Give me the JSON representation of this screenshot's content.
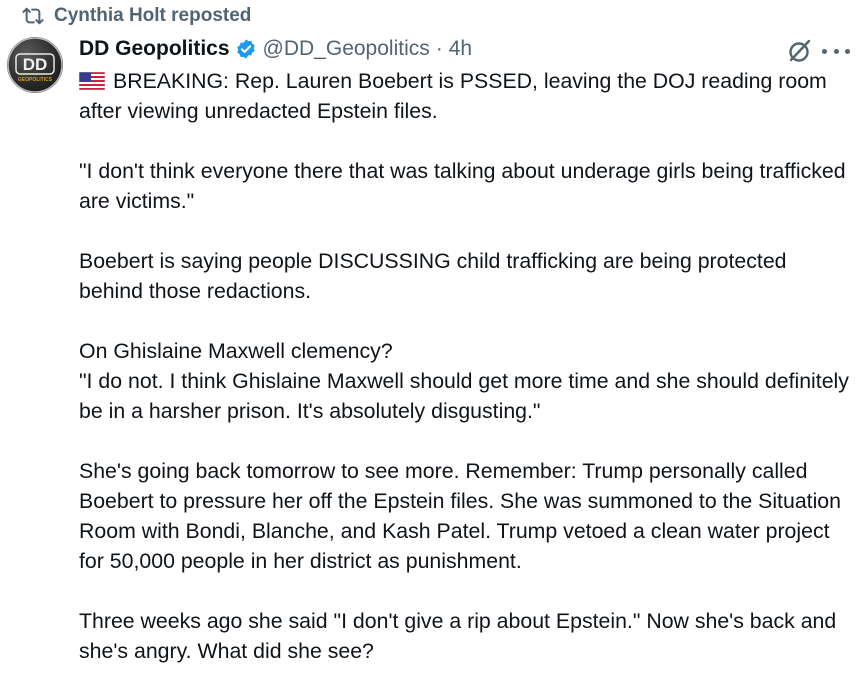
{
  "repost": {
    "label": "Cynthia Holt reposted",
    "icon": "repost-icon"
  },
  "author": {
    "avatar_text": "DD",
    "avatar_subtext": "GEOPOLITICS",
    "display_name": "DD Geopolitics",
    "verified_icon": "verified-badge-icon",
    "verified_color": "#1d9bf0",
    "handle": "@DD_Geopolitics",
    "separator": "·",
    "time": "4h"
  },
  "actions": {
    "grok_icon": "grok-icon",
    "more_icon": "more-icon"
  },
  "tweet": {
    "flag_icon": "us-flag-icon",
    "paragraphs": [
      "BREAKING: Rep. Lauren Boebert is PSSED, leaving the DOJ reading room after viewing unredacted Epstein files.",
      "\"I don't think everyone there that was talking about underage girls being trafficked are victims.\"",
      "Boebert is saying people DISCUSSING child trafficking are being protected behind those redactions.",
      "On Ghislaine Maxwell clemency?",
      "\"I do not. I think Ghislaine Maxwell should get more time and she should definitely be in a harsher prison. It's absolutely disgusting.\"",
      "She's going back tomorrow to see more. Remember: Trump personally called Boebert to pressure her off the Epstein files. She was summoned to the Situation Room with Bondi, Blanche, and Kash Patel. Trump vetoed a clean water project for 50,000 people in her district as punishment.",
      "Three weeks ago she said \"I don't give a rip about Epstein.\" Now she's back and she's angry. What did she see?"
    ]
  },
  "colors": {
    "text": "#0f1419",
    "secondary": "#536471",
    "accent": "#1d9bf0"
  }
}
